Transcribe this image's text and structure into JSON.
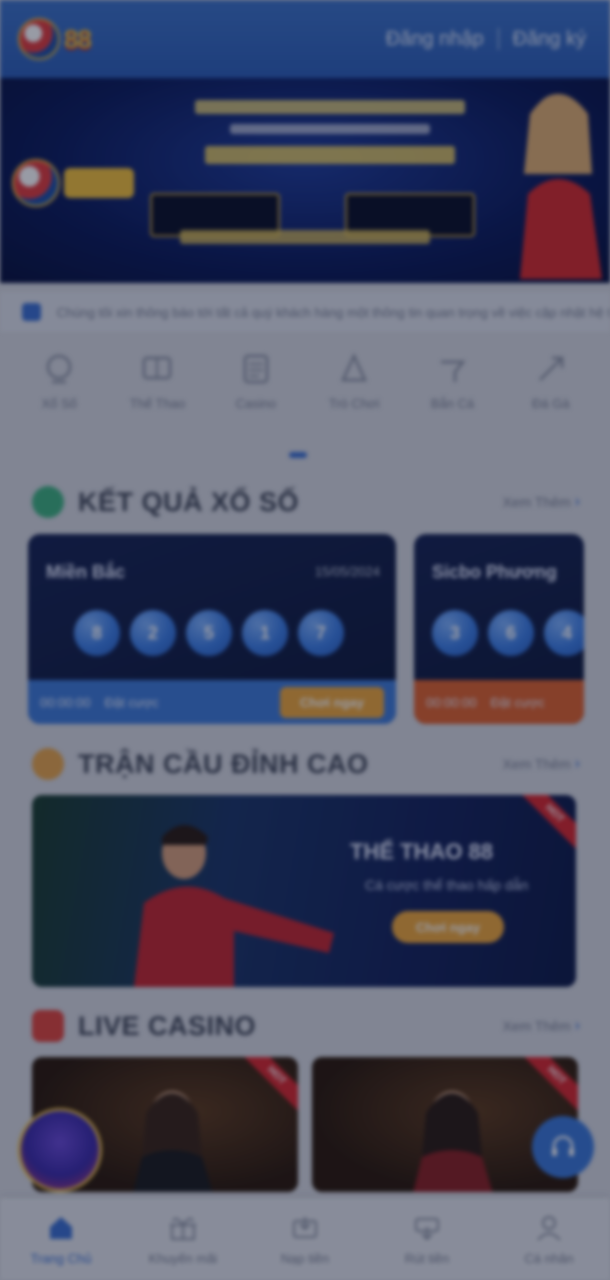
{
  "header": {
    "logo_text": "88",
    "login_label": "Đăng nhập",
    "register_label": "Đăng ký"
  },
  "notice": {
    "text": "Chúng tôi xin thông báo tới tất cả quý khách hàng một thông tin quan trọng về việc cập nhật hệ thống..."
  },
  "quick_menu": [
    {
      "label": "Xổ Số",
      "icon": "lottery-icon"
    },
    {
      "label": "Thể Thao",
      "icon": "sport-icon"
    },
    {
      "label": "Casino",
      "icon": "casino-icon"
    },
    {
      "label": "Trò Chơi",
      "icon": "game-icon"
    },
    {
      "label": "Bắn Cá",
      "icon": "fish-icon"
    },
    {
      "label": "Đá Gà",
      "icon": "cock-icon"
    }
  ],
  "sections": {
    "lottery": {
      "title": "KẾT QUẢ XỔ SỐ",
      "more": "Xem Thêm"
    },
    "sports": {
      "title": "TRẬN CẦU ĐỈNH CAO",
      "more": "Xem Thêm"
    },
    "casino": {
      "title": "LIVE CASINO",
      "more": "Xem Thêm"
    }
  },
  "lottery_cards": [
    {
      "name": "Miền Bắc",
      "date": "15/05/2024",
      "balls": [
        "8",
        "2",
        "5",
        "1",
        "7"
      ],
      "footer_left": "00:00:00",
      "footer_mid": "Đặt cược",
      "button": "Chơi ngay"
    },
    {
      "name": "Sicbo Phương",
      "date": "",
      "balls": [
        "3",
        "6",
        "4"
      ],
      "footer_left": "00:00:00",
      "footer_mid": "Đặt cược",
      "button": ""
    }
  ],
  "sports_banner": {
    "title": "THỂ THAO 88",
    "subtitle": "Cá cược thể thao hấp dẫn",
    "button": "Chơi ngay",
    "ribbon": "HOT"
  },
  "casino_cards": [
    {
      "ribbon": "HOT"
    },
    {
      "ribbon": "HOT"
    }
  ],
  "bottom_nav": [
    {
      "label": "Trang Chủ",
      "icon": "home-icon",
      "active": true
    },
    {
      "label": "Khuyến mãi",
      "icon": "gift-icon",
      "active": false
    },
    {
      "label": "Nạp tiền",
      "icon": "deposit-icon",
      "active": false
    },
    {
      "label": "Rút tiền",
      "icon": "withdraw-icon",
      "active": false
    },
    {
      "label": "Cá nhân",
      "icon": "user-icon",
      "active": false
    }
  ],
  "colors": {
    "primary": "#3b6fd0",
    "header": "#2d5fb8",
    "accent": "#f0a83a",
    "hot": "#d9262b"
  }
}
